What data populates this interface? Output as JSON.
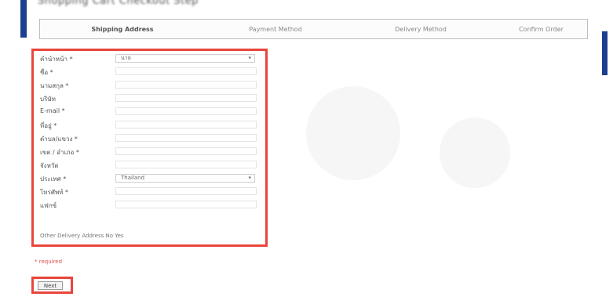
{
  "header": {
    "title": "Shopping Cart Checkout Step",
    "accent": "#1d3f8f"
  },
  "steps": [
    {
      "label": "Shipping Address",
      "active": true
    },
    {
      "label": "Payment Method",
      "active": false
    },
    {
      "label": "Delivery Method",
      "active": false
    },
    {
      "label": "Confirm Order",
      "active": false
    }
  ],
  "form": {
    "highlight_color": "#e8463c",
    "fields": [
      {
        "label": "คำนำหน้า *",
        "type": "select",
        "value": "นาย"
      },
      {
        "label": "ชื่อ *",
        "type": "input",
        "value": ""
      },
      {
        "label": "นามสกุล *",
        "type": "input",
        "value": ""
      },
      {
        "label": "บริษัท",
        "type": "input",
        "value": ""
      },
      {
        "label": "E-mail *",
        "type": "input",
        "value": ""
      },
      {
        "label": "ที่อยู่ *",
        "type": "input",
        "value": ""
      },
      {
        "label": "ตำบล/แขวง *",
        "type": "input",
        "value": ""
      },
      {
        "label": "เขต / อำเภอ *",
        "type": "input",
        "value": ""
      },
      {
        "label": "จังหวัด",
        "type": "input",
        "value": ""
      },
      {
        "label": "ประเทศ *",
        "type": "select",
        "value": "Thailand"
      },
      {
        "label": "โทรศัพท์ *",
        "type": "input",
        "value": ""
      },
      {
        "label": "แฟกซ์",
        "type": "input",
        "value": ""
      }
    ],
    "other_delivery": "Other Delivery Address  No  Yes"
  },
  "required_note": "* required",
  "next_button": "Next"
}
